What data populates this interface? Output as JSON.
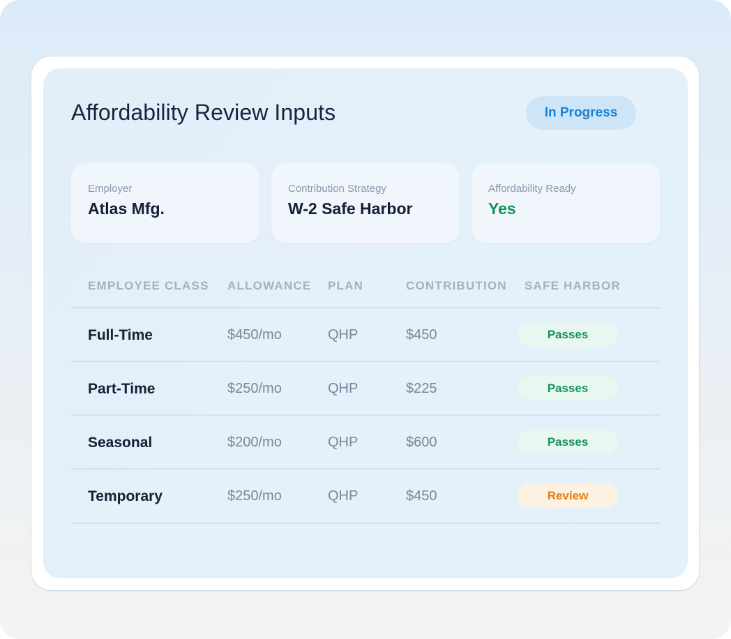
{
  "header": {
    "title": "Affordability Review Inputs",
    "status": "In Progress"
  },
  "summary": [
    {
      "label": "Employer",
      "value": "Atlas Mfg."
    },
    {
      "label": "Contribution Strategy",
      "value": "W-2 Safe Harbor"
    },
    {
      "label": "Affordability Ready",
      "value": "Yes"
    }
  ],
  "table": {
    "columns": [
      "EMPLOYEE CLASS",
      "ALLOWANCE",
      "PLAN",
      "CONTRIBUTION",
      "SAFE HARBOR"
    ],
    "rows": [
      {
        "class": "Full-Time",
        "allowance": "$450/mo",
        "plan": "QHP",
        "contribution": "$450",
        "safe_harbor": "Passes"
      },
      {
        "class": "Part-Time",
        "allowance": "$250/mo",
        "plan": "QHP",
        "contribution": "$225",
        "safe_harbor": "Passes"
      },
      {
        "class": "Seasonal",
        "allowance": "$200/mo",
        "plan": "QHP",
        "contribution": "$600",
        "safe_harbor": "Passes"
      },
      {
        "class": "Temporary",
        "allowance": "$250/mo",
        "plan": "QHP",
        "contribution": "$450",
        "safe_harbor": "Review"
      }
    ]
  },
  "colors": {
    "status_text": "#1a82d6",
    "pass_text": "#14925a",
    "review_text": "#e17e12",
    "ready_text": "#12955c"
  }
}
